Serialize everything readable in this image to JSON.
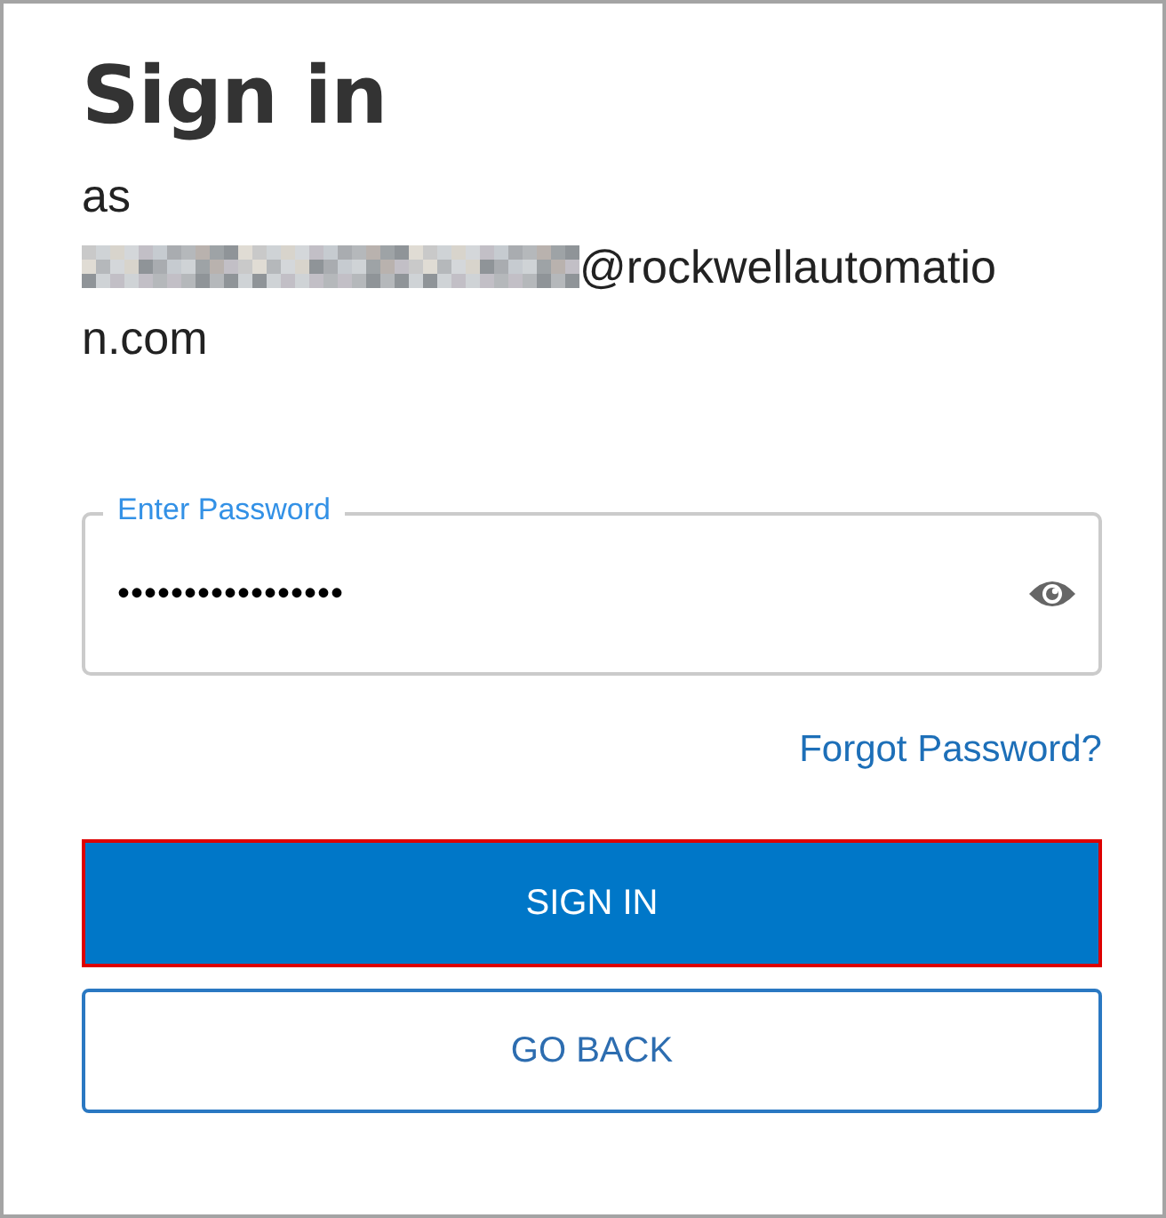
{
  "heading": "Sign in",
  "as_label": "as",
  "account": {
    "email_domain_lines": [
      "@rockwellautomatio",
      "n.com"
    ]
  },
  "password_field": {
    "label": "Enter Password",
    "value": "•••••••••••••••••",
    "reveal_visible": false
  },
  "forgot_link": "Forgot Password?",
  "buttons": [
    {
      "kind": "primary",
      "label": "SIGN IN",
      "focused": true
    },
    {
      "kind": "secondary",
      "label": "GO BACK",
      "focused": false
    }
  ]
}
